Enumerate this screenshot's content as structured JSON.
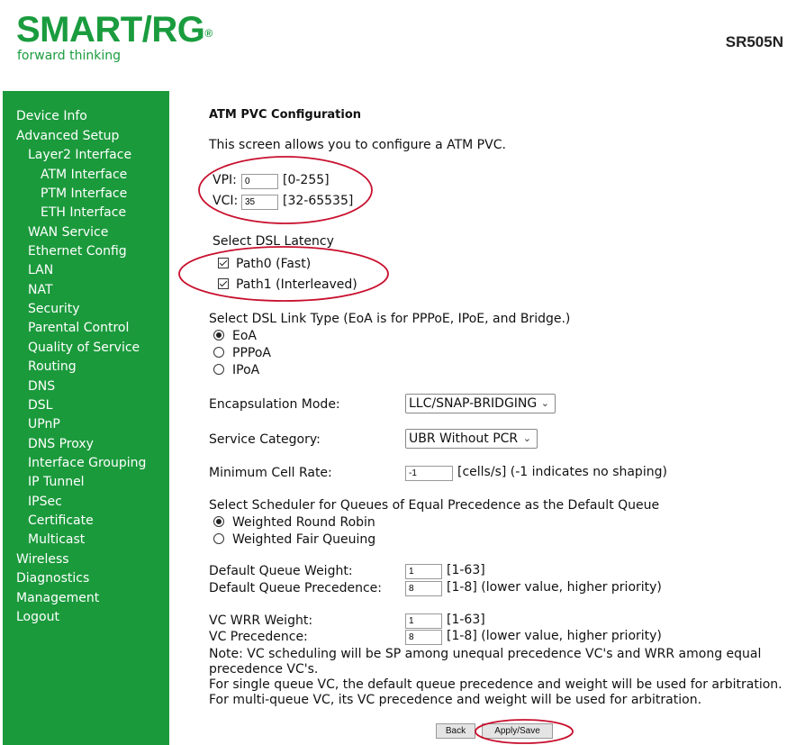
{
  "brand": {
    "logo": "SMART/RG",
    "registered": "®",
    "tagline": "forward thinking",
    "model": "SR505N",
    "color": "#1a9c3e"
  },
  "nav": {
    "device_info": "Device Info",
    "advanced_setup": "Advanced Setup",
    "layer2_interface": "Layer2 Interface",
    "atm_interface": "ATM Interface",
    "ptm_interface": "PTM Interface",
    "eth_interface": "ETH Interface",
    "wan_service": "WAN Service",
    "ethernet_config": "Ethernet Config",
    "lan": "LAN",
    "nat": "NAT",
    "security": "Security",
    "parental_control": "Parental Control",
    "qos": "Quality of Service",
    "routing": "Routing",
    "dns": "DNS",
    "dsl": "DSL",
    "upnp": "UPnP",
    "dns_proxy": "DNS Proxy",
    "interface_grouping": "Interface Grouping",
    "ip_tunnel": "IP Tunnel",
    "ipsec": "IPSec",
    "certificate": "Certificate",
    "multicast": "Multicast",
    "wireless": "Wireless",
    "diagnostics": "Diagnostics",
    "management": "Management",
    "logout": "Logout"
  },
  "form": {
    "title": "ATM PVC Configuration",
    "intro": "This screen allows you to configure a ATM PVC.",
    "vpi": {
      "label": "VPI:",
      "value": "0",
      "range": "[0-255]"
    },
    "vci": {
      "label": "VCI:",
      "value": "35",
      "range": "[32-65535]"
    },
    "latency": {
      "heading": "Select DSL Latency",
      "path0": "Path0 (Fast)",
      "path1": "Path1 (Interleaved)"
    },
    "link_type": {
      "heading": "Select DSL Link Type (EoA is for PPPoE, IPoE, and Bridge.)",
      "eoa": "EoA",
      "pppoa": "PPPoA",
      "ipoa": "IPoA"
    },
    "encapsulation": {
      "label": "Encapsulation Mode:",
      "value": "LLC/SNAP-BRIDGING"
    },
    "service_category": {
      "label": "Service Category:",
      "value": "UBR Without PCR"
    },
    "min_cell_rate": {
      "label": "Minimum Cell Rate:",
      "value": "-1",
      "hint": "[cells/s] (-1 indicates no shaping)"
    },
    "scheduler": {
      "heading": "Select Scheduler for Queues of Equal Precedence as the Default Queue",
      "wrr": "Weighted Round Robin",
      "wfq": "Weighted Fair Queuing"
    },
    "default_queue_weight": {
      "label": "Default Queue Weight:",
      "value": "1",
      "hint": "[1-63]"
    },
    "default_queue_precedence": {
      "label": "Default Queue Precedence:",
      "value": "8",
      "hint": "[1-8] (lower value, higher priority)"
    },
    "vc_wrr_weight": {
      "label": "VC WRR Weight:",
      "value": "1",
      "hint": "[1-63]"
    },
    "vc_precedence": {
      "label": "VC Precedence:",
      "value": "8",
      "hint": "[1-8] (lower value, higher priority)"
    },
    "note1": "Note: VC scheduling will be SP among unequal precedence VC's and WRR among equal",
    "note2": "precedence VC's.",
    "note3": "For single queue VC, the default queue precedence and weight will be used for arbitration.",
    "note4": "For multi-queue VC, its VC precedence and weight will be used for arbitration.",
    "back_button": "Back",
    "apply_button": "Apply/Save"
  },
  "colors": {
    "sidebar": "#1b9a3c",
    "annotation": "#c8102e"
  }
}
